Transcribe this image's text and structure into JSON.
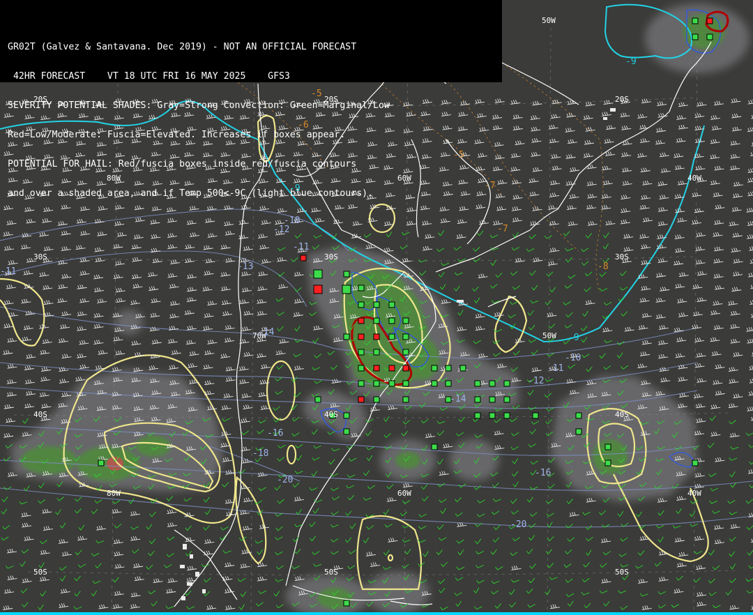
{
  "header": {
    "line1": "GR02T (Galvez & Santavana. Dec 2019) - NOT AN OFFICIAL FORECAST",
    "line2": " 42HR FORECAST    VT 18 UTC FRI 16 MAY 2025    GFS3",
    "line3": "SEVERITY POTENTIAL SHADES: Gray=Strong Convection: Green=Marginal/Low",
    "line4": "Red=Low/Moderate: Fuscia=Elevated. Increases if boxes appear.",
    "line5": "POTENTIAL FOR HAIL: Red/fuscia boxes inside red/fuscia contours",
    "line6": "and over a shaded area, and if Temp 500<-9C (light blue contours)."
  },
  "coords": {
    "lon_50w_top": "50W",
    "lat_20s_a": "20S",
    "lat_20s_b": "20S",
    "lat_20s_c": "20S",
    "lon_80w_a": "80W",
    "lon_60w_a": "60W",
    "lon_40w_a": "40W",
    "lat_30s_a": "30S",
    "lat_30s_b": "30S",
    "lat_30s_c": "30S",
    "lon_70w": "70W",
    "lon_50w_mid": "50W",
    "lat_40s_a": "40S",
    "lat_40s_b": "40S",
    "lat_40s_c": "40S",
    "lon_80w_b": "80W",
    "lon_60w_b": "60W",
    "lon_40w_b": "40W",
    "lat_50s_a": "50S",
    "lat_50s_b": "50S",
    "lat_50s_c": "50S"
  },
  "temps": {
    "t_m9_top": "-9",
    "t_m9_arg": "-9",
    "t_m9_east": "-9",
    "t_m5_a": "-5",
    "t_m6": "-6",
    "t_m5_b": "-5",
    "t_m7_a": "-7",
    "t_m7_b": "-7",
    "t_m8": "-8",
    "t_m10_a": "-10",
    "t_m11_a": "-11",
    "t_m12_a": "-12",
    "t_m13": "-13",
    "t_m14_a": "-14",
    "t_m11_b": "-11",
    "t_m10_b": "-10",
    "t_m11_c": "-11",
    "t_m12_b": "-12",
    "t_m14_b": "-14",
    "t_m16_a": "-16",
    "t_m18": "-18",
    "t_m20_a": "-20",
    "t_m16_b": "-16",
    "t_m20_b": "-20"
  },
  "colors": {
    "background": "#3b3b39",
    "gray_shade": "#6b6b6d",
    "green_shade": "#4f8a3c",
    "red_shade": "#c0504d",
    "yellow_contour": "#f0e68c",
    "cyan_isotherm": "#22d3e6",
    "blue_contour": "#2f5be0",
    "temp_label": "#9fb4e8",
    "orange_label": "#d68a2a",
    "green_box": "#3ddc4a",
    "red_box": "#ff2020",
    "wind_green": "#2bd42b",
    "wind_white": "#e8e8e8"
  }
}
